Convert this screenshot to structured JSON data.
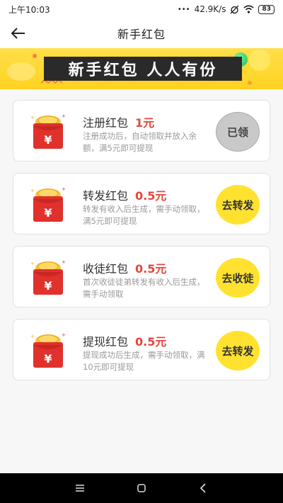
{
  "status_bar": {
    "time": "上午10:03",
    "dots": "•••",
    "net_speed": "42.9K/s",
    "battery": "83"
  },
  "nav": {
    "title": "新手红包"
  },
  "banner": {
    "text": "新手红包  人人有份"
  },
  "cards": [
    {
      "title": "注册红包",
      "amount": "1元",
      "desc": "注册成功后，自动领取并放入余额，满5元即可提现",
      "button": "已领",
      "state": "done"
    },
    {
      "title": "转发红包",
      "amount": "0.5元",
      "desc": "转发有收入后生成，需手动领取，满5元即可提现",
      "button": "去转发",
      "state": "go"
    },
    {
      "title": "收徒红包",
      "amount": "0.5元",
      "desc": "首次收徒徒弟转发有收入后生成，需手动领取",
      "button": "去收徒",
      "state": "go"
    },
    {
      "title": "提现红包",
      "amount": "0.5元",
      "desc": "提现成功后生成，需手动领取，满10元即可提现",
      "button": "去转发",
      "state": "go"
    }
  ],
  "icons": {
    "back": "arrow-left-icon",
    "envelope": "red-envelope-icon",
    "menu": "menu-icon",
    "home": "home-icon",
    "sys_back": "back-icon"
  },
  "colors": {
    "accent_yellow": "#ffe230",
    "amount_red": "#e8453c",
    "envelope_red": "#e0312c",
    "disabled_gray": "#c9c9c9"
  }
}
